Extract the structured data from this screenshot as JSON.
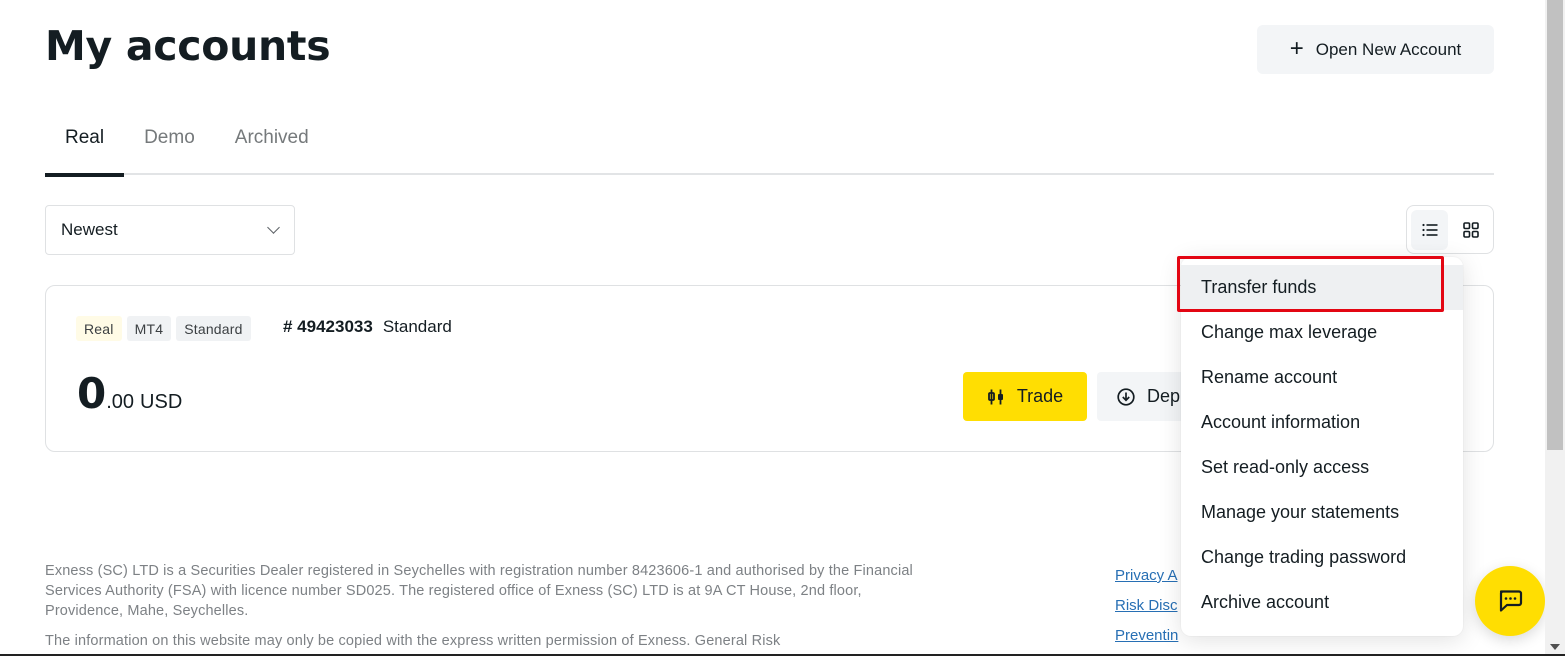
{
  "header": {
    "title": "My accounts",
    "open_account_label": "Open New Account",
    "open_account_icon": "plus-icon"
  },
  "tabs": [
    {
      "label": "Real",
      "active": true
    },
    {
      "label": "Demo",
      "active": false
    },
    {
      "label": "Archived",
      "active": false
    }
  ],
  "sort": {
    "selected": "Newest"
  },
  "view_toggle": {
    "options": [
      {
        "icon": "list-view-icon",
        "active": true
      },
      {
        "icon": "grid-view-icon",
        "active": false
      }
    ]
  },
  "account": {
    "badges": [
      "Real",
      "MT4",
      "Standard"
    ],
    "number": "# 49423033",
    "type": "Standard",
    "balance_int": "0",
    "balance_dec": ".00",
    "currency": "USD",
    "trade_label": "Trade",
    "deposit_label": "Dep",
    "accent_color": "#ffde02"
  },
  "menu": {
    "items": [
      {
        "label": "Transfer funds",
        "highlighted": true
      },
      {
        "label": "Change max leverage"
      },
      {
        "label": "Rename account"
      },
      {
        "label": "Account information"
      },
      {
        "label": "Set read-only access"
      },
      {
        "label": "Manage your statements"
      },
      {
        "label": "Change trading password"
      },
      {
        "label": "Archive account"
      }
    ],
    "highlight_color": "#e30613"
  },
  "footer": {
    "paragraph1": "Exness (SC) LTD is a Securities Dealer registered in Seychelles with registration number 8423606-1 and authorised by the Financial Services Authority (FSA) with licence number SD025. The registered office of Exness (SC) LTD is at 9A CT House, 2nd floor, Providence, Mahe, Seychelles.",
    "paragraph2": "The information on this website may only be copied with the express written permission of Exness. General Risk",
    "links": [
      "Privacy A",
      "Risk Disc",
      "Preventin"
    ]
  },
  "chat": {
    "icon": "chat-icon"
  }
}
